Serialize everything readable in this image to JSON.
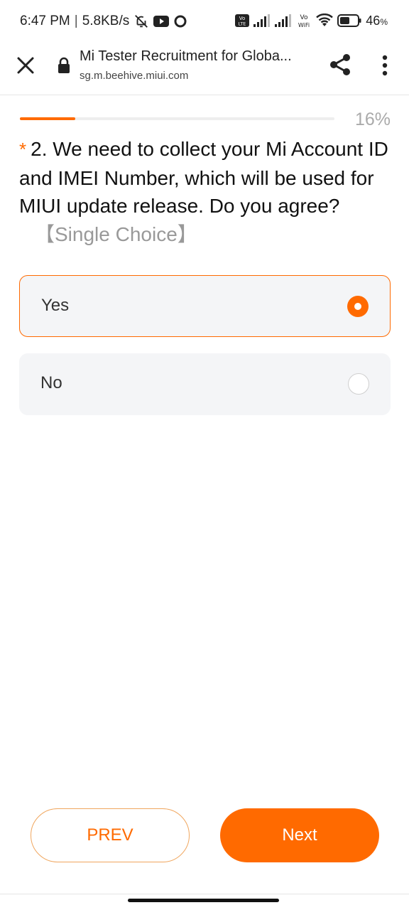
{
  "status_bar": {
    "time": "6:47 PM",
    "separator": "|",
    "speed": "5.8KB/s",
    "battery_percent": "46",
    "battery_unit": "%",
    "volte_label": "Vo LTE",
    "vowifi_label": "Vo WiFi",
    "icons": [
      "bell-off-icon",
      "youtube-icon",
      "circle-icon",
      "volte-icon",
      "signal-icon",
      "signal-icon",
      "vowifi-icon",
      "wifi-icon",
      "battery-icon"
    ]
  },
  "browser": {
    "title": "Mi Tester Recruitment for Globa...",
    "url": "sg.m.beehive.miui.com",
    "icons": [
      "close-icon",
      "lock-icon",
      "share-icon",
      "more-vertical-icon"
    ]
  },
  "progress": {
    "value": 0.16,
    "label": "16%"
  },
  "question": {
    "required_marker": "*",
    "text": "2. We need to collect your Mi Account ID and IMEI Number, which will be used for MIUI update release. Do you agree?",
    "type_label": "【Single Choice】"
  },
  "options": [
    {
      "label": "Yes",
      "selected": true
    },
    {
      "label": "No",
      "selected": false
    }
  ],
  "buttons": {
    "prev": "PREV",
    "next": "Next"
  },
  "colors": {
    "accent": "#ff6a00",
    "option_bg": "#f4f5f7",
    "muted": "#aaaaaa"
  }
}
